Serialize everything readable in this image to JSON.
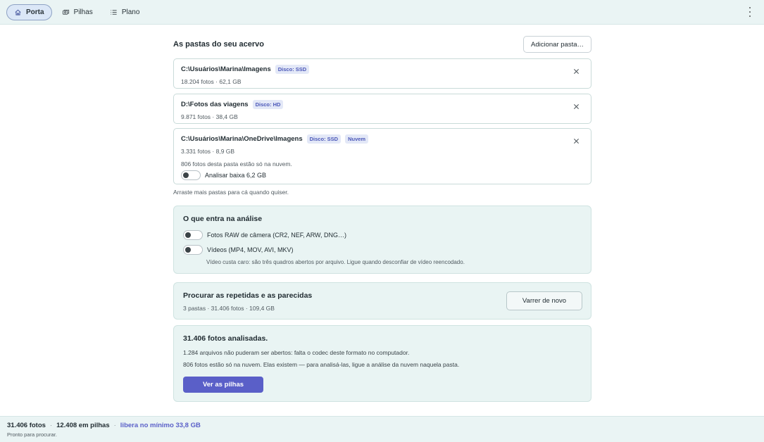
{
  "nav": {
    "tabs": [
      {
        "label": "Porta",
        "icon": "home-icon",
        "active": true
      },
      {
        "label": "Pilhas",
        "icon": "stack-icon",
        "active": false
      },
      {
        "label": "Plano",
        "icon": "list-icon",
        "active": false
      }
    ],
    "menu_icon": "kebab-menu-icon"
  },
  "folders_section": {
    "title": "As pastas do seu acervo",
    "add_button": "Adicionar pasta…",
    "folders": [
      {
        "path": "C:\\Usuários\\Marina\\Imagens",
        "tags": [
          "Disco: SSD"
        ],
        "meta": "18.204 fotos · 62,1 GB"
      },
      {
        "path": "D:\\Fotos das viagens",
        "tags": [
          "Disco: HD"
        ],
        "meta": "9.871 fotos · 38,4 GB"
      },
      {
        "path": "C:\\Usuários\\Marina\\OneDrive\\Imagens",
        "tags": [
          "Disco: SSD",
          "Nuvem"
        ],
        "meta": "3.331 fotos · 8,9 GB",
        "note": "806 fotos desta pasta estão só na nuvem.",
        "toggle_label": "Analisar baixa 6,2 GB"
      }
    ],
    "hint": "Arraste mais pastas para cá quando quiser."
  },
  "analysis": {
    "title": "O que entra na análise",
    "raw_toggle": "Fotos RAW de câmera (CR2, NEF, ARW, DNG…)",
    "video_toggle": "Vídeos (MP4, MOV, AVI, MKV)",
    "video_hint": "Vídeo custa caro: são três quadros abertos por arquivo. Ligue quando desconfiar de vídeo reencodado."
  },
  "scan": {
    "title": "Procurar as repetidas e as parecidas",
    "meta": "3 pastas · 31.406 fotos · 109,4 GB",
    "button": "Varrer de novo"
  },
  "result": {
    "title": "31.406 fotos analisadas.",
    "line1": "1.284 arquivos não puderam ser abertos: falta o codec deste formato no computador.",
    "line2": "806 fotos estão só na nuvem. Elas existem — para analisá-las, ligue a análise da nuvem naquela pasta.",
    "button": "Ver as pilhas"
  },
  "status": {
    "photos": "31.406 fotos",
    "piles": "12.408 em pilhas",
    "frees": "libera no mínimo 33,8 GB",
    "ready": "Pronto para procurar.",
    "separator": "·"
  },
  "colors": {
    "accent": "#5a5fc8",
    "panel_bg": "#e9f4f3",
    "bar_bg": "#eaf4f4"
  }
}
